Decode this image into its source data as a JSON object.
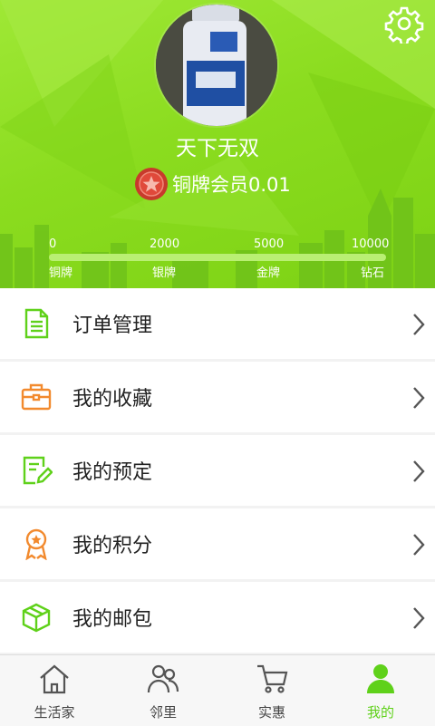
{
  "profile": {
    "username": "天下无双",
    "member_level": "铜牌会员0.01"
  },
  "levels": [
    {
      "points": "0",
      "name": "铜牌"
    },
    {
      "points": "2000",
      "name": "银牌"
    },
    {
      "points": "5000",
      "name": "金牌"
    },
    {
      "points": "10000",
      "name": "钻石"
    }
  ],
  "progress": 0.0,
  "menu": [
    {
      "label": "订单管理",
      "icon": "document-icon"
    },
    {
      "label": "我的收藏",
      "icon": "briefcase-icon"
    },
    {
      "label": "我的预定",
      "icon": "edit-note-icon"
    },
    {
      "label": "我的积分",
      "icon": "award-icon"
    },
    {
      "label": "我的邮包",
      "icon": "package-icon"
    }
  ],
  "tabs": [
    {
      "label": "生活家",
      "icon": "home-icon"
    },
    {
      "label": "邻里",
      "icon": "people-icon"
    },
    {
      "label": "实惠",
      "icon": "cart-icon"
    },
    {
      "label": "我的",
      "icon": "person-icon",
      "active": true
    }
  ],
  "colors": {
    "accent": "#5fd11a",
    "orange": "#f28a2e",
    "header_green": "#8bdc1f"
  }
}
